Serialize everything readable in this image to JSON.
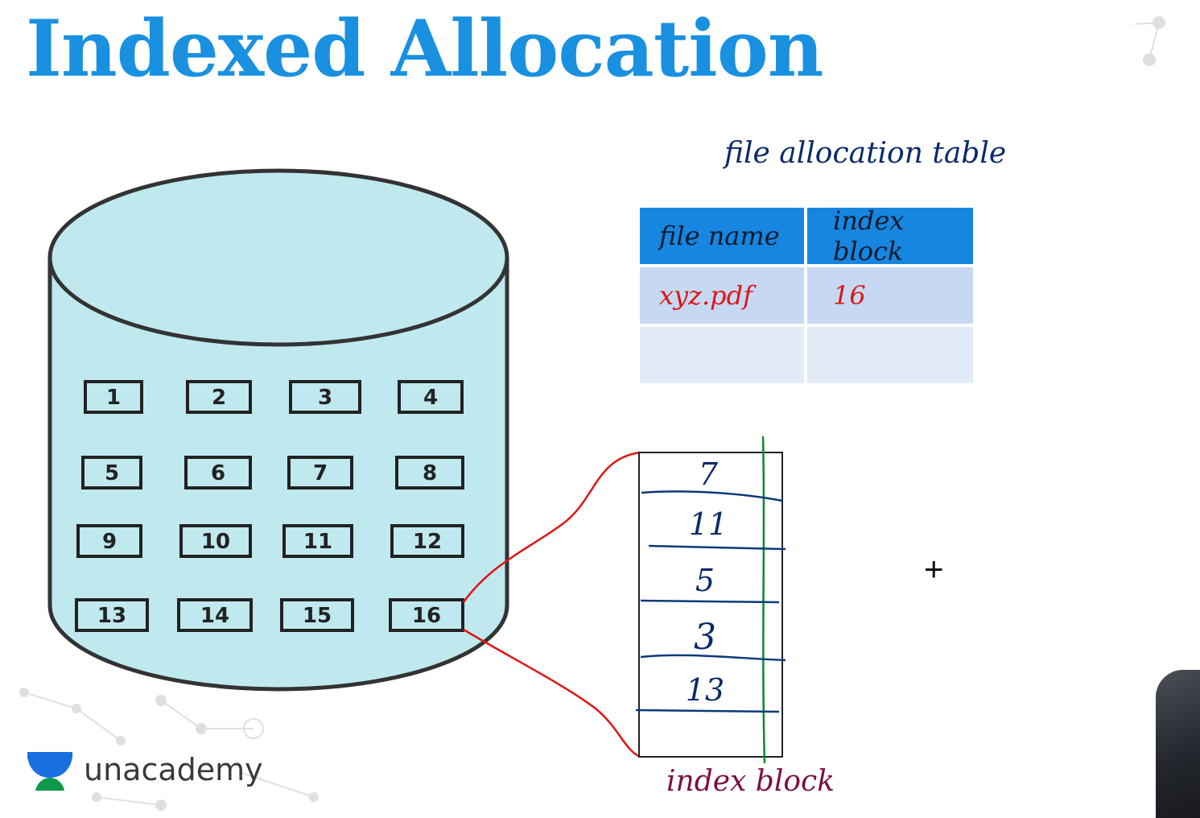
{
  "slide": {
    "title": "Indexed Allocation"
  },
  "disk": {
    "blocks": [
      "1",
      "2",
      "3",
      "4",
      "5",
      "6",
      "7",
      "8",
      "9",
      "10",
      "11",
      "12",
      "13",
      "14",
      "15",
      "16"
    ]
  },
  "fat": {
    "title": "file allocation table",
    "headers": [
      "file name",
      "index block"
    ],
    "rows": [
      [
        "xyz.pdf",
        "16"
      ],
      [
        "",
        ""
      ]
    ]
  },
  "index_block": {
    "label": "index block",
    "entries": [
      "7",
      "11",
      "5",
      "3",
      "13"
    ]
  },
  "brand": {
    "name": "unacademy"
  },
  "colors": {
    "title": "#1a90e0",
    "disk_fill": "#bfe9ee",
    "table_header": "#1686e0",
    "highlight": "#e01515",
    "index_lines": "#0a3a7a",
    "index_divider": "#0a8a2a"
  },
  "icons": {
    "cursor": "crosshair-cursor-icon",
    "logo": "unacademy-logo-icon"
  }
}
